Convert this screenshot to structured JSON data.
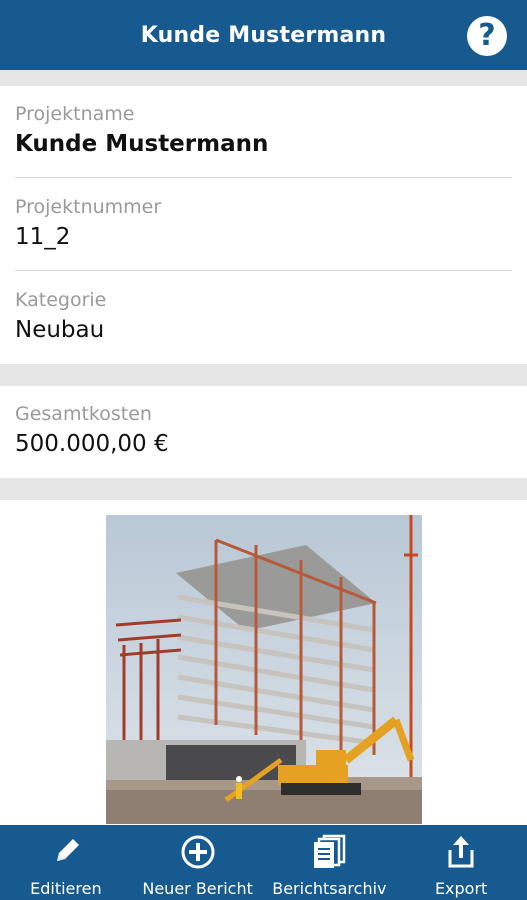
{
  "header": {
    "title": "Kunde Mustermann",
    "help_label": "?"
  },
  "project": {
    "name_label": "Projektname",
    "name_value": "Kunde Mustermann",
    "number_label": "Projektnummer",
    "number_value": "11_2",
    "category_label": "Kategorie",
    "category_value": "Neubau"
  },
  "costs": {
    "label": "Gesamtkosten",
    "value": "500.000,00 €"
  },
  "nav": [
    {
      "label": "Editieren",
      "icon": "pencil-icon"
    },
    {
      "label": "Neuer Bericht",
      "icon": "plus-circle-icon"
    },
    {
      "label": "Berichtsarchiv",
      "icon": "documents-icon"
    },
    {
      "label": "Export",
      "icon": "share-icon"
    }
  ],
  "colors": {
    "brand": "#165a8f",
    "divider": "#e6e6e6",
    "label": "#9a9a9a"
  }
}
